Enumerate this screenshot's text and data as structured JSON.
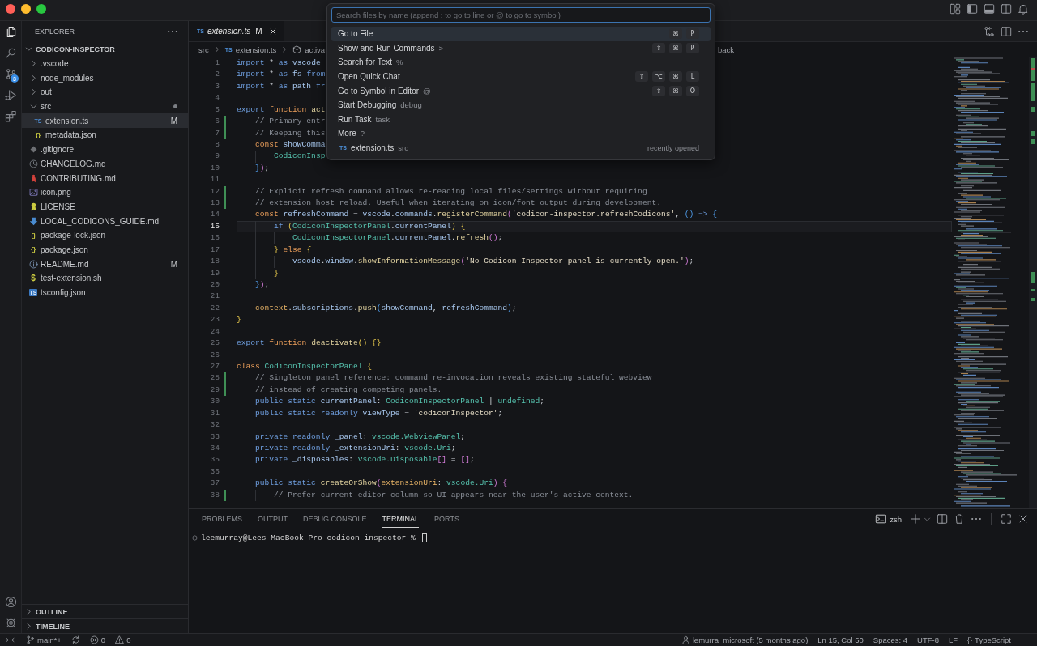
{
  "activity_bar": {
    "items": [
      {
        "kind": "explorer",
        "selected": true
      },
      {
        "kind": "search",
        "selected": false
      },
      {
        "kind": "source-control",
        "selected": false,
        "badge": "3"
      },
      {
        "kind": "run-debug",
        "selected": false
      },
      {
        "kind": "extensions",
        "selected": false
      }
    ],
    "bottom": [
      {
        "kind": "account"
      },
      {
        "kind": "settings"
      }
    ]
  },
  "sidebar": {
    "title": "EXPLORER",
    "root": {
      "label": "CODICON-INSPECTOR",
      "expanded": true,
      "children": [
        {
          "kind": "folder",
          "name": ".vscode",
          "expanded": false,
          "selected": false,
          "dot": false
        },
        {
          "kind": "folder",
          "name": "node_modules",
          "expanded": false,
          "selected": false,
          "dot": false
        },
        {
          "kind": "folder",
          "name": "out",
          "expanded": false,
          "selected": false,
          "dot": false
        },
        {
          "kind": "folder",
          "name": "src",
          "expanded": true,
          "selected": false,
          "dot": true,
          "children": [
            {
              "kind": "typescript",
              "glyph": "TS",
              "name": "extension.ts",
              "status": "M",
              "selected": true,
              "dot": false
            },
            {
              "kind": "json",
              "glyph": "{}",
              "name": "metadata.json",
              "selected": false,
              "dot": false
            }
          ]
        },
        {
          "kind": "gitignore",
          "name": ".gitignore",
          "selected": false,
          "dot": false
        },
        {
          "kind": "changelog",
          "name": "CHANGELOG.md",
          "selected": false,
          "dot": false
        },
        {
          "kind": "contributing",
          "name": "CONTRIBUTING.md",
          "selected": false,
          "dot": false
        },
        {
          "kind": "image",
          "name": "icon.png",
          "selected": false,
          "dot": false
        },
        {
          "kind": "license",
          "name": "LICENSE",
          "selected": false,
          "dot": false
        },
        {
          "kind": "markdown",
          "name": "LOCAL_CODICONS_GUIDE.md",
          "selected": false,
          "dot": false
        },
        {
          "kind": "json",
          "glyph": "{}",
          "name": "package-lock.json",
          "selected": false,
          "dot": false
        },
        {
          "kind": "json",
          "glyph": "{}",
          "name": "package.json",
          "selected": false,
          "dot": false
        },
        {
          "kind": "readme",
          "name": "README.md",
          "status": "M",
          "selected": false,
          "dot": false
        },
        {
          "kind": "shell",
          "glyph": "$",
          "name": "test-extension.sh",
          "selected": false,
          "dot": false
        },
        {
          "kind": "tsconfig",
          "glyph": "TS",
          "name": "tsconfig.json",
          "selected": false,
          "dot": false
        }
      ]
    },
    "sections": [
      {
        "label": "OUTLINE",
        "expanded": false
      },
      {
        "label": "TIMELINE",
        "expanded": false
      }
    ]
  },
  "editor": {
    "tabs": [
      {
        "glyph": "TS",
        "label": "extension.ts",
        "status": "M",
        "selected": true,
        "preview": true
      }
    ],
    "breadcrumbs": [
      {
        "kind": "folder",
        "label": "src"
      },
      {
        "kind": "file",
        "glyph": "TS",
        "label": "extension.ts"
      },
      {
        "kind": "symbol",
        "label": "activat"
      }
    ],
    "breadcrumb_tail": "back",
    "lines": [
      {
        "number": "1",
        "current": false,
        "changed": false,
        "tokens": [
          {
            "kind": "keyword",
            "text": "import"
          },
          {
            "kind": "plain",
            "text": " * "
          },
          {
            "kind": "keyword",
            "text": "as"
          },
          {
            "kind": "variable",
            "text": " vscode"
          }
        ]
      },
      {
        "number": "2",
        "current": false,
        "changed": false,
        "tokens": [
          {
            "kind": "keyword",
            "text": "import"
          },
          {
            "kind": "plain",
            "text": " * "
          },
          {
            "kind": "keyword",
            "text": "as"
          },
          {
            "kind": "variable",
            "text": " fs "
          },
          {
            "kind": "keyword",
            "text": "from"
          }
        ]
      },
      {
        "number": "3",
        "current": false,
        "changed": false,
        "tokens": [
          {
            "kind": "keyword",
            "text": "import"
          },
          {
            "kind": "plain",
            "text": " * "
          },
          {
            "kind": "keyword",
            "text": "as"
          },
          {
            "kind": "variable",
            "text": " path "
          },
          {
            "kind": "keyword",
            "text": "fr"
          }
        ]
      },
      {
        "number": "4",
        "current": false,
        "changed": false
      },
      {
        "number": "5",
        "current": false,
        "changed": false,
        "tokens": [
          {
            "kind": "keyword",
            "text": "export "
          },
          {
            "kind": "storage",
            "text": "function "
          },
          {
            "kind": "function",
            "text": "act"
          }
        ]
      },
      {
        "number": "6",
        "current": false,
        "changed": true,
        "tokens": [
          {
            "kind": "comment",
            "text": "    // Primary entr"
          }
        ]
      },
      {
        "number": "7",
        "current": false,
        "changed": true,
        "tokens": [
          {
            "kind": "comment",
            "text": "    // Keeping this"
          }
        ]
      },
      {
        "number": "8",
        "current": false,
        "changed": false,
        "tokens": [
          {
            "kind": "storage",
            "text": "    const "
          },
          {
            "kind": "variable",
            "text": "showComma"
          }
        ]
      },
      {
        "number": "9",
        "current": false,
        "changed": false,
        "tokens": [
          {
            "kind": "type",
            "text": "        CodiconInsp"
          }
        ]
      },
      {
        "number": "10",
        "current": false,
        "changed": false,
        "tokens": [
          {
            "kind": "bracket3",
            "text": "    }"
          },
          {
            "kind": "bracket2",
            "text": ")"
          },
          {
            "kind": "plain",
            "text": ";"
          }
        ]
      },
      {
        "number": "11",
        "current": false,
        "changed": false
      },
      {
        "number": "12",
        "current": false,
        "changed": true,
        "tokens": [
          {
            "kind": "comment",
            "text": "    // Explicit refresh command allows re-reading local files/settings without requiring"
          }
        ]
      },
      {
        "number": "13",
        "current": false,
        "changed": true,
        "tokens": [
          {
            "kind": "comment",
            "text": "    // extension host reload. Useful when iterating on icon/font output during development."
          }
        ]
      },
      {
        "number": "14",
        "current": false,
        "changed": false,
        "tokens": [
          {
            "kind": "storage",
            "text": "    const "
          },
          {
            "kind": "variable",
            "text": "refreshCommand"
          },
          {
            "kind": "plain",
            "text": " = "
          },
          {
            "kind": "variable",
            "text": "vscode"
          },
          {
            "kind": "plain",
            "text": "."
          },
          {
            "kind": "variable",
            "text": "commands"
          },
          {
            "kind": "plain",
            "text": "."
          },
          {
            "kind": "function",
            "text": "registerCommand"
          },
          {
            "kind": "bracket2",
            "text": "("
          },
          {
            "kind": "string",
            "text": "'codicon-inspector.refreshCodicons'"
          },
          {
            "kind": "plain",
            "text": ", "
          },
          {
            "kind": "bracket3",
            "text": "()"
          },
          {
            "kind": "keyword",
            "text": " => "
          },
          {
            "kind": "bracket3",
            "text": "{"
          }
        ]
      },
      {
        "number": "15",
        "current": true,
        "changed": false,
        "tokens": [
          {
            "kind": "keyword",
            "text": "        if "
          },
          {
            "kind": "bracket1",
            "text": "("
          },
          {
            "kind": "type",
            "text": "CodiconInspectorPanel"
          },
          {
            "kind": "plain",
            "text": "."
          },
          {
            "kind": "variable",
            "text": "currentPanel"
          },
          {
            "kind": "bracket1",
            "text": ")"
          },
          {
            "kind": "bracket1",
            "text": " {"
          }
        ]
      },
      {
        "number": "16",
        "current": false,
        "changed": false,
        "tokens": [
          {
            "kind": "type",
            "text": "            CodiconInspectorPanel"
          },
          {
            "kind": "plain",
            "text": "."
          },
          {
            "kind": "variable",
            "text": "currentPanel"
          },
          {
            "kind": "plain",
            "text": "."
          },
          {
            "kind": "function",
            "text": "refresh"
          },
          {
            "kind": "bracket2",
            "text": "()"
          },
          {
            "kind": "plain",
            "text": ";"
          }
        ]
      },
      {
        "number": "17",
        "current": false,
        "changed": false,
        "tokens": [
          {
            "kind": "bracket1",
            "text": "        }"
          },
          {
            "kind": "storage",
            "text": " else "
          },
          {
            "kind": "bracket1",
            "text": "{"
          }
        ]
      },
      {
        "number": "18",
        "current": false,
        "changed": false,
        "tokens": [
          {
            "kind": "variable",
            "text": "            vscode"
          },
          {
            "kind": "plain",
            "text": "."
          },
          {
            "kind": "variable",
            "text": "window"
          },
          {
            "kind": "plain",
            "text": "."
          },
          {
            "kind": "function",
            "text": "showInformationMessage"
          },
          {
            "kind": "bracket2",
            "text": "("
          },
          {
            "kind": "string",
            "text": "'No Codicon Inspector panel is currently open.'"
          },
          {
            "kind": "bracket2",
            "text": ")"
          },
          {
            "kind": "plain",
            "text": ";"
          }
        ]
      },
      {
        "number": "19",
        "current": false,
        "changed": false,
        "tokens": [
          {
            "kind": "bracket1",
            "text": "        }"
          }
        ]
      },
      {
        "number": "20",
        "current": false,
        "changed": false,
        "tokens": [
          {
            "kind": "bracket3",
            "text": "    }"
          },
          {
            "kind": "bracket2",
            "text": ")"
          },
          {
            "kind": "plain",
            "text": ";"
          }
        ]
      },
      {
        "number": "21",
        "current": false,
        "changed": false
      },
      {
        "number": "22",
        "current": false,
        "changed": false,
        "tokens": [
          {
            "kind": "parameter",
            "text": "    context"
          },
          {
            "kind": "plain",
            "text": "."
          },
          {
            "kind": "variable",
            "text": "subscriptions"
          },
          {
            "kind": "plain",
            "text": "."
          },
          {
            "kind": "function",
            "text": "push"
          },
          {
            "kind": "bracket3",
            "text": "("
          },
          {
            "kind": "variable",
            "text": "showCommand"
          },
          {
            "kind": "plain",
            "text": ", "
          },
          {
            "kind": "variable",
            "text": "refreshCommand"
          },
          {
            "kind": "bracket3",
            "text": ")"
          },
          {
            "kind": "plain",
            "text": ";"
          }
        ]
      },
      {
        "number": "23",
        "current": false,
        "changed": false,
        "tokens": [
          {
            "kind": "bracket1",
            "text": "}"
          }
        ]
      },
      {
        "number": "24",
        "current": false,
        "changed": false
      },
      {
        "number": "25",
        "current": false,
        "changed": false,
        "tokens": [
          {
            "kind": "keyword",
            "text": "export "
          },
          {
            "kind": "storage",
            "text": "function "
          },
          {
            "kind": "function",
            "text": "deactivate"
          },
          {
            "kind": "bracket1",
            "text": "()"
          },
          {
            "kind": "bracket1",
            "text": " {}"
          }
        ]
      },
      {
        "number": "26",
        "current": false,
        "changed": false
      },
      {
        "number": "27",
        "current": false,
        "changed": false,
        "tokens": [
          {
            "kind": "storage",
            "text": "class "
          },
          {
            "kind": "type",
            "text": "CodiconInspectorPanel"
          },
          {
            "kind": "bracket1",
            "text": " {"
          }
        ]
      },
      {
        "number": "28",
        "current": false,
        "changed": true,
        "tokens": [
          {
            "kind": "comment",
            "text": "    // Singleton panel reference: command re-invocation reveals existing stateful webview"
          }
        ]
      },
      {
        "number": "29",
        "current": false,
        "changed": true,
        "tokens": [
          {
            "kind": "comment",
            "text": "    // instead of creating competing panels."
          }
        ]
      },
      {
        "number": "30",
        "current": false,
        "changed": false,
        "tokens": [
          {
            "kind": "keyword",
            "text": "    public static "
          },
          {
            "kind": "variable",
            "text": "currentPanel"
          },
          {
            "kind": "plain",
            "text": ": "
          },
          {
            "kind": "type",
            "text": "CodiconInspectorPanel"
          },
          {
            "kind": "plain",
            "text": " | "
          },
          {
            "kind": "type",
            "text": "undefined"
          },
          {
            "kind": "plain",
            "text": ";"
          }
        ]
      },
      {
        "number": "31",
        "current": false,
        "changed": false,
        "tokens": [
          {
            "kind": "keyword",
            "text": "    public static readonly "
          },
          {
            "kind": "variable",
            "text": "viewType"
          },
          {
            "kind": "plain",
            "text": " = "
          },
          {
            "kind": "string",
            "text": "'codiconInspector'"
          },
          {
            "kind": "plain",
            "text": ";"
          }
        ]
      },
      {
        "number": "32",
        "current": false,
        "changed": false
      },
      {
        "number": "33",
        "current": false,
        "changed": false,
        "tokens": [
          {
            "kind": "keyword",
            "text": "    private readonly "
          },
          {
            "kind": "variable",
            "text": "_panel"
          },
          {
            "kind": "plain",
            "text": ": "
          },
          {
            "kind": "type",
            "text": "vscode.WebviewPanel"
          },
          {
            "kind": "plain",
            "text": ";"
          }
        ]
      },
      {
        "number": "34",
        "current": false,
        "changed": false,
        "tokens": [
          {
            "kind": "keyword",
            "text": "    private readonly "
          },
          {
            "kind": "variable",
            "text": "_extensionUri"
          },
          {
            "kind": "plain",
            "text": ": "
          },
          {
            "kind": "type",
            "text": "vscode.Uri"
          },
          {
            "kind": "plain",
            "text": ";"
          }
        ]
      },
      {
        "number": "35",
        "current": false,
        "changed": false,
        "tokens": [
          {
            "kind": "keyword",
            "text": "    private "
          },
          {
            "kind": "variable",
            "text": "_disposables"
          },
          {
            "kind": "plain",
            "text": ": "
          },
          {
            "kind": "type",
            "text": "vscode.Disposable"
          },
          {
            "kind": "bracket2",
            "text": "[]"
          },
          {
            "kind": "plain",
            "text": " = "
          },
          {
            "kind": "bracket2",
            "text": "[]"
          },
          {
            "kind": "plain",
            "text": ";"
          }
        ]
      },
      {
        "number": "36",
        "current": false,
        "changed": false
      },
      {
        "number": "37",
        "current": false,
        "changed": false,
        "tokens": [
          {
            "kind": "keyword",
            "text": "    public static "
          },
          {
            "kind": "function",
            "text": "createOrShow"
          },
          {
            "kind": "bracket2",
            "text": "("
          },
          {
            "kind": "parameter",
            "text": "extensionUri"
          },
          {
            "kind": "plain",
            "text": ": "
          },
          {
            "kind": "type",
            "text": "vscode.Uri"
          },
          {
            "kind": "bracket2",
            "text": ")"
          },
          {
            "kind": "bracket2",
            "text": " {"
          }
        ]
      },
      {
        "number": "38",
        "current": false,
        "changed": true,
        "tokens": [
          {
            "kind": "comment",
            "text": "        // Prefer current editor column so UI appears near the user's active context."
          }
        ]
      }
    ]
  },
  "quick_open": {
    "placeholder": "Search files by name (append : to go to line or @ to go to symbol)",
    "items": [
      {
        "kind": "command",
        "label": "Go to File",
        "keys": [
          "⌘",
          "P"
        ],
        "selected": true
      },
      {
        "kind": "command",
        "label": "Show and Run Commands",
        "prefix": ">",
        "keys": [
          "⇧",
          "⌘",
          "P"
        ],
        "selected": false
      },
      {
        "kind": "command",
        "label": "Search for Text",
        "prefix": "%",
        "selected": false
      },
      {
        "kind": "command",
        "label": "Open Quick Chat",
        "keys": [
          "⇧",
          "⌥",
          "⌘",
          "L"
        ],
        "selected": false
      },
      {
        "kind": "command",
        "label": "Go to Symbol in Editor",
        "prefix": "@",
        "keys": [
          "⇧",
          "⌘",
          "O"
        ],
        "selected": false
      },
      {
        "kind": "command",
        "label": "Start Debugging",
        "prefix": "debug",
        "selected": false
      },
      {
        "kind": "command",
        "label": "Run Task",
        "prefix": "task",
        "selected": false
      },
      {
        "kind": "command",
        "label": "More",
        "prefix": "?",
        "selected": false
      },
      {
        "kind": "file",
        "glyph": "TS",
        "label": "extension.ts",
        "description": "src",
        "detail": "recently opened",
        "selected": false
      }
    ]
  },
  "panel": {
    "tabs": [
      {
        "label": "PROBLEMS",
        "selected": false
      },
      {
        "label": "OUTPUT",
        "selected": false
      },
      {
        "label": "DEBUG CONSOLE",
        "selected": false
      },
      {
        "label": "TERMINAL",
        "selected": true
      },
      {
        "label": "PORTS",
        "selected": false
      }
    ],
    "terminal_name": "zsh",
    "terminal_lines": [
      {
        "prompt": "leemurray@Lees-MacBook-Pro codicon-inspector %"
      }
    ]
  },
  "status_bar": {
    "left": [
      {
        "kind": "remote"
      },
      {
        "kind": "branch",
        "text": "main*+"
      },
      {
        "kind": "sync"
      },
      {
        "kind": "errors",
        "text": "0"
      },
      {
        "kind": "warnings",
        "text": "0"
      }
    ],
    "right": [
      {
        "kind": "blame",
        "text": "lemurra_microsoft (5 months ago)"
      },
      {
        "kind": "text",
        "text": "Ln 15, Col 50"
      },
      {
        "kind": "text",
        "text": "Spaces: 4"
      },
      {
        "kind": "text",
        "text": "UTF-8"
      },
      {
        "kind": "text",
        "text": "LF"
      },
      {
        "kind": "language",
        "glyph": "{}",
        "text": "TypeScript"
      }
    ]
  }
}
